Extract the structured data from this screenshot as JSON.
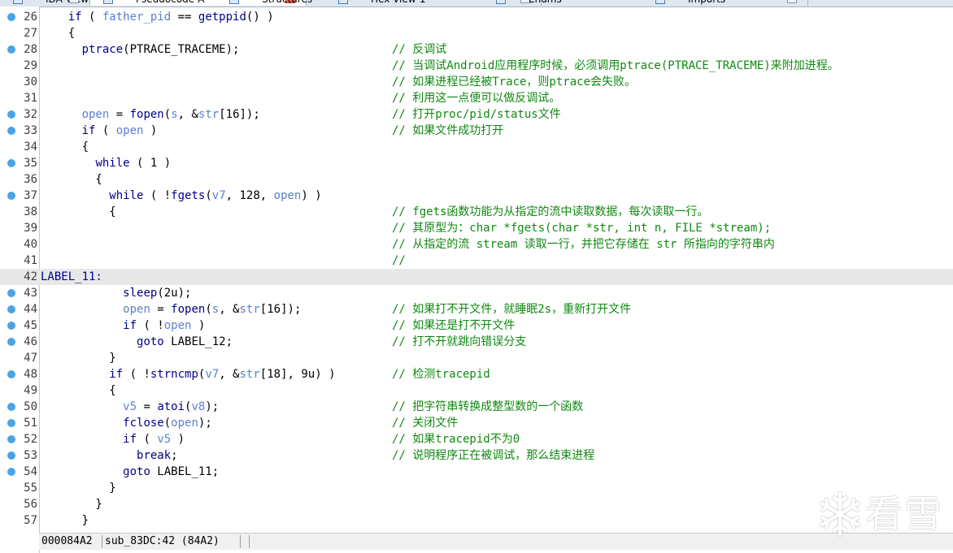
{
  "tabs": [
    {
      "label": "IDA View-A",
      "active": false
    },
    {
      "label": "Pseudocode-A",
      "active": true
    },
    {
      "label": "Structures",
      "active": false
    },
    {
      "label": "Hex View-1",
      "active": false
    },
    {
      "label": "Enums",
      "active": false
    },
    {
      "label": "Imports",
      "active": false
    }
  ],
  "lines": [
    {
      "num": "26",
      "bp": true,
      "code": [
        [
          "    ",
          ""
        ],
        [
          "if",
          "k"
        ],
        [
          " ( ",
          ""
        ],
        [
          "father_pid",
          "v"
        ],
        [
          " == ",
          ""
        ],
        [
          "getppid",
          "k"
        ],
        [
          "() )",
          ""
        ]
      ],
      "comment": ""
    },
    {
      "num": "27",
      "bp": false,
      "code": [
        [
          "    {",
          ""
        ]
      ],
      "comment": ""
    },
    {
      "num": "28",
      "bp": true,
      "code": [
        [
          "      ",
          ""
        ],
        [
          "ptrace",
          "k"
        ],
        [
          "(PTRACE_TRACEME);",
          ""
        ]
      ],
      "comment": "// 反调试"
    },
    {
      "num": "29",
      "bp": false,
      "code": [],
      "comment": "// 当调试Android应用程序时候，必须调用ptrace(PTRACE_TRACEME)来附加进程。"
    },
    {
      "num": "30",
      "bp": false,
      "code": [],
      "comment": "// 如果进程已经被Trace，则ptrace会失败。"
    },
    {
      "num": "31",
      "bp": false,
      "code": [],
      "comment": "// 利用这一点便可以做反调试。"
    },
    {
      "num": "32",
      "bp": true,
      "code": [
        [
          "      ",
          ""
        ],
        [
          "open",
          "v"
        ],
        [
          " = ",
          ""
        ],
        [
          "fopen",
          "k"
        ],
        [
          "(",
          ""
        ],
        [
          "s",
          "v"
        ],
        [
          ", &",
          ""
        ],
        [
          "str",
          "v"
        ],
        [
          "[16]);",
          ""
        ]
      ],
      "comment": "// 打开proc/pid/status文件"
    },
    {
      "num": "33",
      "bp": true,
      "code": [
        [
          "      ",
          ""
        ],
        [
          "if",
          "k"
        ],
        [
          " ( ",
          ""
        ],
        [
          "open",
          "v"
        ],
        [
          " )",
          ""
        ]
      ],
      "comment": "// 如果文件成功打开"
    },
    {
      "num": "34",
      "bp": false,
      "code": [
        [
          "      {",
          ""
        ]
      ],
      "comment": ""
    },
    {
      "num": "35",
      "bp": true,
      "code": [
        [
          "        ",
          ""
        ],
        [
          "while",
          "k"
        ],
        [
          " ( 1 )",
          ""
        ]
      ],
      "comment": ""
    },
    {
      "num": "36",
      "bp": false,
      "code": [
        [
          "        {",
          ""
        ]
      ],
      "comment": ""
    },
    {
      "num": "37",
      "bp": true,
      "code": [
        [
          "          ",
          ""
        ],
        [
          "while",
          "k"
        ],
        [
          " ( !",
          ""
        ],
        [
          "fgets",
          "k"
        ],
        [
          "(",
          ""
        ],
        [
          "v7",
          "v"
        ],
        [
          ", 128, ",
          ""
        ],
        [
          "open",
          "v"
        ],
        [
          ") )",
          ""
        ]
      ],
      "comment": ""
    },
    {
      "num": "38",
      "bp": false,
      "code": [
        [
          "          {",
          ""
        ]
      ],
      "comment": "// fgets函数功能为从指定的流中读取数据，每次读取一行。"
    },
    {
      "num": "39",
      "bp": false,
      "code": [],
      "comment": "// 其原型为：char *fgets(char *str, int n, FILE *stream);"
    },
    {
      "num": "40",
      "bp": false,
      "code": [],
      "comment": "// 从指定的流 stream 读取一行，并把它存储在 str 所指向的字符串内"
    },
    {
      "num": "41",
      "bp": false,
      "code": [],
      "comment": "//"
    },
    {
      "num": "42",
      "bp": false,
      "hl": true,
      "code": [
        [
          "LABEL_11:",
          "label"
        ]
      ],
      "comment": ""
    },
    {
      "num": "43",
      "bp": true,
      "code": [
        [
          "            ",
          ""
        ],
        [
          "sleep",
          "k"
        ],
        [
          "(2u);",
          ""
        ]
      ],
      "comment": ""
    },
    {
      "num": "44",
      "bp": true,
      "code": [
        [
          "            ",
          ""
        ],
        [
          "open",
          "v"
        ],
        [
          " = ",
          ""
        ],
        [
          "fopen",
          "k"
        ],
        [
          "(",
          ""
        ],
        [
          "s",
          "v"
        ],
        [
          ", &",
          ""
        ],
        [
          "str",
          "v"
        ],
        [
          "[16]);",
          ""
        ]
      ],
      "comment": "// 如果打不开文件，就睡眠2s，重新打开文件"
    },
    {
      "num": "45",
      "bp": true,
      "code": [
        [
          "            ",
          ""
        ],
        [
          "if",
          "k"
        ],
        [
          " ( !",
          ""
        ],
        [
          "open",
          "v"
        ],
        [
          " )",
          ""
        ]
      ],
      "comment": "// 如果还是打不开文件"
    },
    {
      "num": "46",
      "bp": true,
      "code": [
        [
          "              ",
          ""
        ],
        [
          "goto",
          "k"
        ],
        [
          " LABEL_12;",
          ""
        ]
      ],
      "comment": "// 打不开就跳向错误分支"
    },
    {
      "num": "47",
      "bp": false,
      "code": [
        [
          "          }",
          ""
        ]
      ],
      "comment": ""
    },
    {
      "num": "48",
      "bp": true,
      "code": [
        [
          "          ",
          ""
        ],
        [
          "if",
          "k"
        ],
        [
          " ( !",
          ""
        ],
        [
          "strncmp",
          "k"
        ],
        [
          "(",
          ""
        ],
        [
          "v7",
          "v"
        ],
        [
          ", &",
          ""
        ],
        [
          "str",
          "v"
        ],
        [
          "[18], 9u) )",
          ""
        ]
      ],
      "comment": "// 检测tracepid"
    },
    {
      "num": "49",
      "bp": false,
      "code": [
        [
          "          {",
          ""
        ]
      ],
      "comment": ""
    },
    {
      "num": "50",
      "bp": true,
      "code": [
        [
          "            ",
          ""
        ],
        [
          "v5",
          "v"
        ],
        [
          " = ",
          ""
        ],
        [
          "atoi",
          "k"
        ],
        [
          "(",
          ""
        ],
        [
          "v8",
          "v"
        ],
        [
          ");",
          ""
        ]
      ],
      "comment": "// 把字符串转换成整型数的一个函数"
    },
    {
      "num": "51",
      "bp": true,
      "code": [
        [
          "            ",
          ""
        ],
        [
          "fclose",
          "k"
        ],
        [
          "(",
          ""
        ],
        [
          "open",
          "v"
        ],
        [
          ");",
          ""
        ]
      ],
      "comment": "// 关闭文件"
    },
    {
      "num": "52",
      "bp": true,
      "code": [
        [
          "            ",
          ""
        ],
        [
          "if",
          "k"
        ],
        [
          " ( ",
          ""
        ],
        [
          "v5",
          "v"
        ],
        [
          " )",
          ""
        ]
      ],
      "comment": "// 如果tracepid不为0"
    },
    {
      "num": "53",
      "bp": true,
      "code": [
        [
          "              ",
          ""
        ],
        [
          "break",
          "k"
        ],
        [
          ";",
          ""
        ]
      ],
      "comment": "// 说明程序正在被调试，那么结束进程"
    },
    {
      "num": "54",
      "bp": true,
      "code": [
        [
          "            ",
          ""
        ],
        [
          "goto",
          "k"
        ],
        [
          " LABEL_11;",
          ""
        ]
      ],
      "comment": ""
    },
    {
      "num": "55",
      "bp": false,
      "code": [
        [
          "          }",
          ""
        ]
      ],
      "comment": ""
    },
    {
      "num": "56",
      "bp": false,
      "code": [
        [
          "        }",
          ""
        ]
      ],
      "comment": ""
    },
    {
      "num": "57",
      "bp": false,
      "code": [
        [
          "      }",
          ""
        ]
      ],
      "comment": ""
    }
  ],
  "status": {
    "address": "000084A2",
    "location": "sub_83DC:42 (84A2)"
  },
  "watermark": {
    "text": "看雪",
    "icon": "snowflake-icon"
  },
  "colors": {
    "keyword": "#00008b",
    "variable": "#5a7fd2",
    "comment": "#118811",
    "breakpoint": "#4aa3e6",
    "highlight_row": "#e8e8e8"
  }
}
